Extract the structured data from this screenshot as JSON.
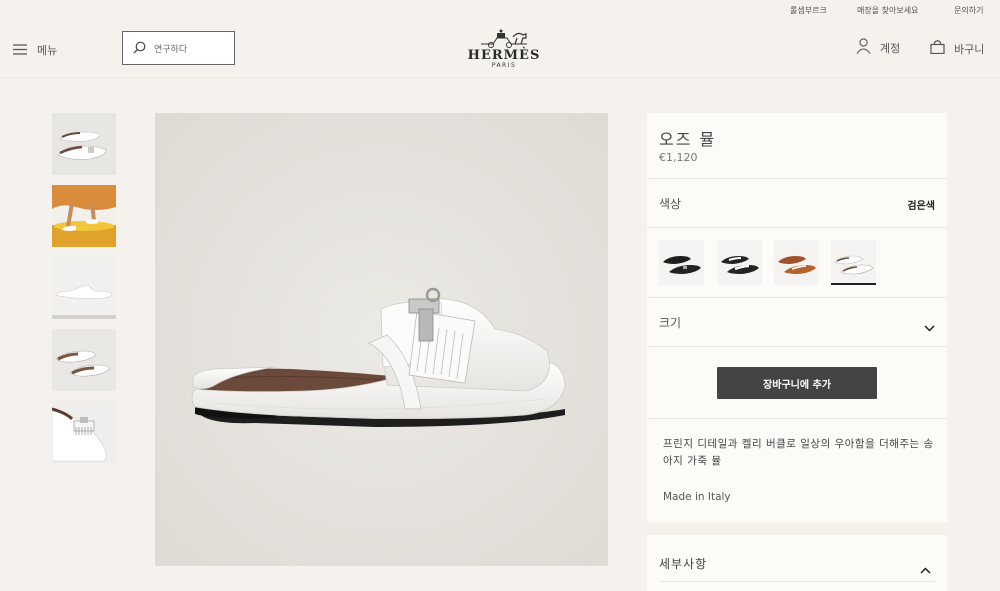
{
  "top_links": [
    "롤셈부르크",
    "매장을 찾아보세요",
    "문의하기"
  ],
  "header": {
    "menu_label": "메뉴",
    "search_placeholder": "연구하다",
    "logo_word": "HERMÈS",
    "logo_sub": "PARIS",
    "account_label": "계정",
    "cart_label": "바구니"
  },
  "product": {
    "name": "오즈 뮬",
    "price": "€1,120",
    "color_label": "색상",
    "color_value": "검은색",
    "size_label": "크기",
    "add_to_cart": "장바구니에 추가",
    "description": "프린지 디테일과 켈리 버클로 일상의 우아함을 더해주는 송아지 가죽 뮬",
    "made_in": "Made in Italy",
    "details_label": "세부사항"
  },
  "colors": {
    "accent": "#444444",
    "background": "#f5f1ec",
    "panel": "#fdfbf8"
  }
}
